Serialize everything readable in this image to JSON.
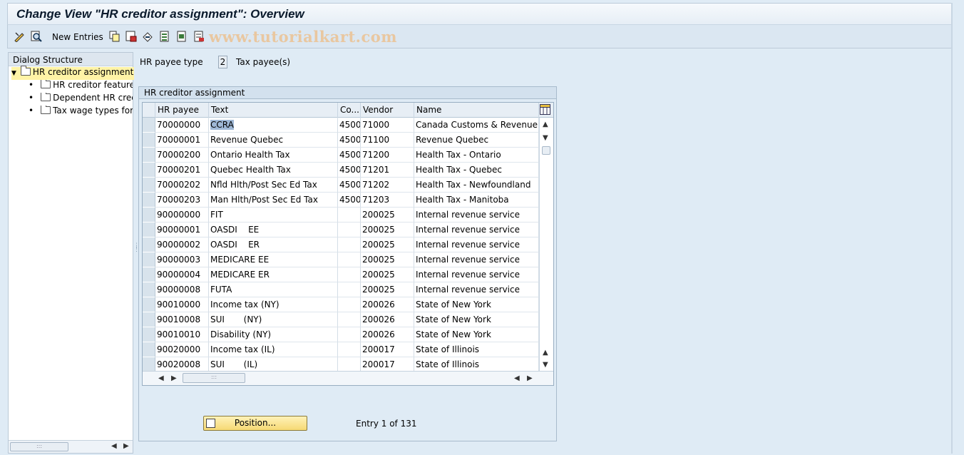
{
  "window": {
    "title": "Change View \"HR creditor assignment\": Overview"
  },
  "toolbar": {
    "new_entries_label": "New Entries",
    "watermark": "www.tutorialkart.com",
    "icons": [
      "display-change-icon",
      "find-icon",
      "copy-icon",
      "delete-icon",
      "undo-icon",
      "select-all-icon",
      "select-block-icon",
      "deselect-all-icon"
    ]
  },
  "dialog_structure": {
    "title": "Dialog Structure",
    "items": [
      {
        "label": "HR creditor assignment",
        "selected": true
      },
      {
        "label": "HR creditor features"
      },
      {
        "label": "Dependent HR credit"
      },
      {
        "label": "Tax wage types for I"
      }
    ]
  },
  "header_fields": {
    "payee_type_label": "HR payee type",
    "payee_type_value": "2",
    "payee_type_desc": "Tax payee(s)"
  },
  "table": {
    "group_title": "HR creditor assignment",
    "columns": [
      "HR payee",
      "Text",
      "Co...",
      "Vendor",
      "Name"
    ],
    "rows": [
      [
        "70000000",
        "CCRA",
        "4500",
        "71000",
        "Canada Customs & Revenue Ag"
      ],
      [
        "70000001",
        "Revenue Quebec",
        "4500",
        "71100",
        "Revenue Quebec"
      ],
      [
        "70000200",
        "Ontario Health Tax",
        "4500",
        "71200",
        "Health Tax - Ontario"
      ],
      [
        "70000201",
        "Quebec Health Tax",
        "4500",
        "71201",
        "Health Tax - Quebec"
      ],
      [
        "70000202",
        "Nfld Hlth/Post Sec Ed Tax",
        "4500",
        "71202",
        "Health Tax - Newfoundland"
      ],
      [
        "70000203",
        "Man Hlth/Post Sec Ed Tax",
        "4500",
        "71203",
        "Health Tax - Manitoba"
      ],
      [
        "90000000",
        "FIT",
        "",
        "200025",
        "Internal revenue service"
      ],
      [
        "90000001",
        "OASDI    EE",
        "",
        "200025",
        "Internal revenue service"
      ],
      [
        "90000002",
        "OASDI    ER",
        "",
        "200025",
        "Internal revenue service"
      ],
      [
        "90000003",
        "MEDICARE EE",
        "",
        "200025",
        "Internal revenue service"
      ],
      [
        "90000004",
        "MEDICARE ER",
        "",
        "200025",
        "Internal revenue service"
      ],
      [
        "90000008",
        "FUTA",
        "",
        "200025",
        "Internal revenue service"
      ],
      [
        "90010000",
        "Income tax (NY)",
        "",
        "200026",
        "State of New York"
      ],
      [
        "90010008",
        "SUI       (NY)",
        "",
        "200026",
        "State of New York"
      ],
      [
        "90010010",
        "Disability (NY)",
        "",
        "200026",
        "State of New York"
      ],
      [
        "90020000",
        "Income tax (IL)",
        "",
        "200017",
        "State of Illinois"
      ],
      [
        "90020008",
        "SUI       (IL)",
        "",
        "200017",
        "State of Illinois"
      ]
    ]
  },
  "footer": {
    "position_button": "Position...",
    "entry_info": "Entry 1 of 131"
  },
  "colors": {
    "background": "#dfebf5",
    "selected_tree": "#fff3a6",
    "button": "#f6d974"
  }
}
